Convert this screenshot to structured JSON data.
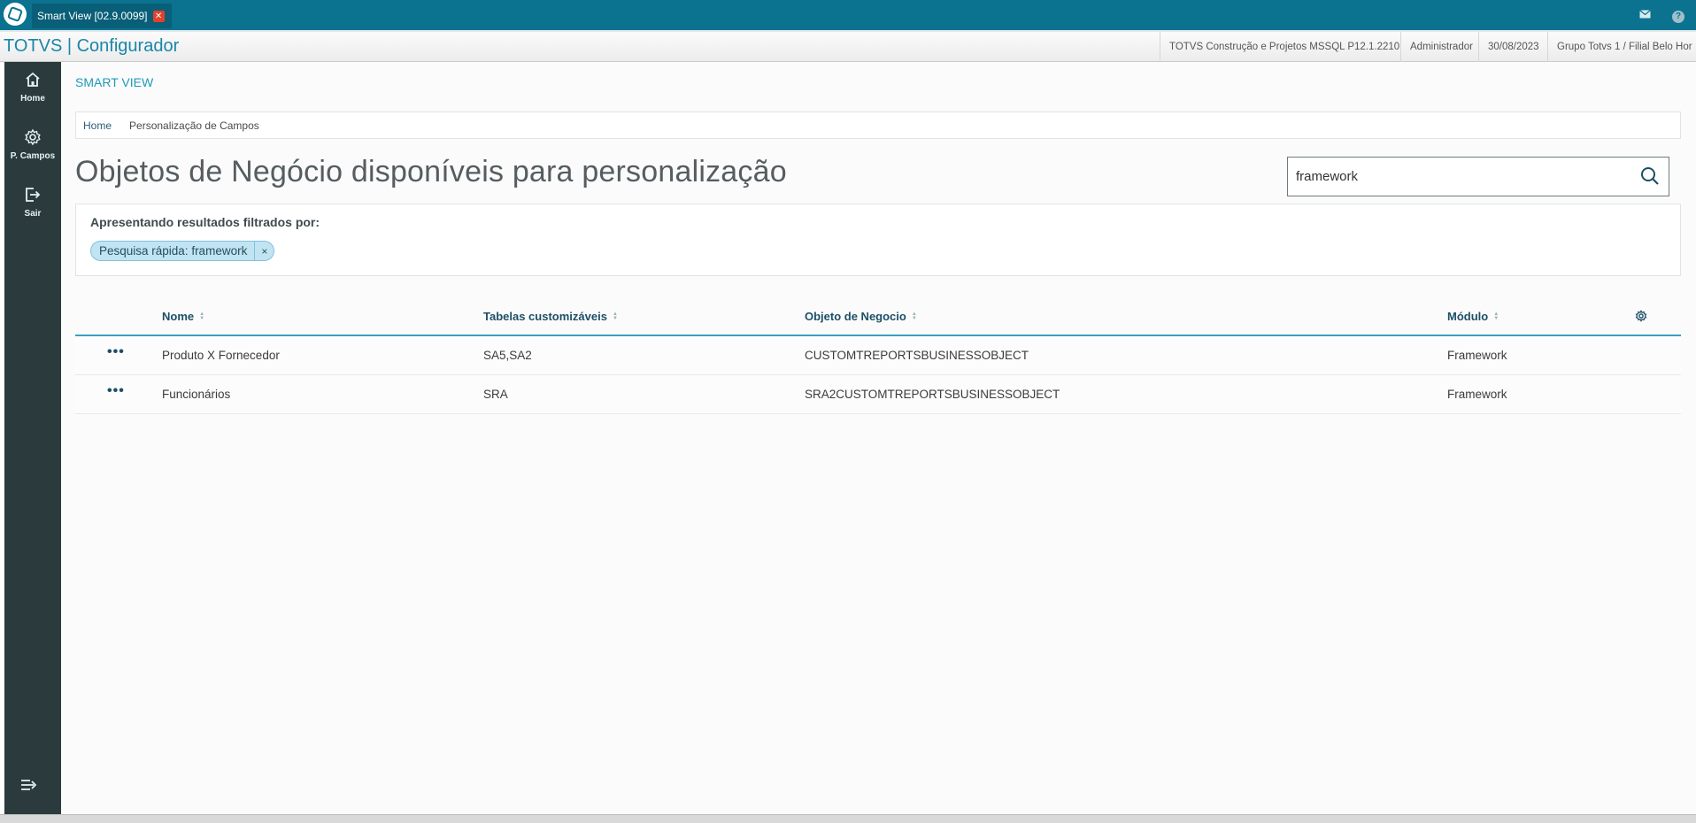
{
  "window": {
    "tab_label": "Smart View [02.9.0099]",
    "close_symbol": "✕"
  },
  "header": {
    "app_title": "TOTVS | Configurador",
    "environment": "TOTVS Construção e Projetos MSSQL P12.1.2210",
    "user": "Administrador",
    "date": "30/08/2023",
    "branch": "Grupo Totvs 1 / Filial Belo Hor"
  },
  "sidebar": {
    "items": [
      {
        "label": "Home",
        "icon": "home-icon"
      },
      {
        "label": "P. Campos",
        "icon": "gear-icon"
      },
      {
        "label": "Sair",
        "icon": "logout-icon"
      }
    ]
  },
  "main": {
    "section_title": "SMART VIEW",
    "breadcrumb": [
      "Home",
      "Personalização de Campos"
    ],
    "page_title": "Objetos de Negócio disponíveis para personalização",
    "search": {
      "value": "framework"
    },
    "filter": {
      "title": "Apresentando resultados filtrados por:",
      "chip_label": "Pesquisa rápida: framework",
      "chip_remove": "×"
    },
    "table": {
      "more_symbol": "•••",
      "columns": [
        "Nome",
        "Tabelas customizáveis",
        "Objeto de Negocio",
        "Módulo"
      ],
      "rows": [
        {
          "nome": "Produto X Fornecedor",
          "tabelas": "SA5,SA2",
          "objeto": "CUSTOMTREPORTSBUSINESSOBJECT",
          "modulo": "Framework"
        },
        {
          "nome": "Funcionários",
          "tabelas": "SRA",
          "objeto": "SRA2CUSTOMTREPORTSBUSINESSOBJECT",
          "modulo": "Framework"
        }
      ]
    }
  },
  "colors": {
    "topbar": "#0b7290",
    "sidebar": "#2b3a3c",
    "accent": "#1e9ab8",
    "chip": "#c2e4f2"
  }
}
